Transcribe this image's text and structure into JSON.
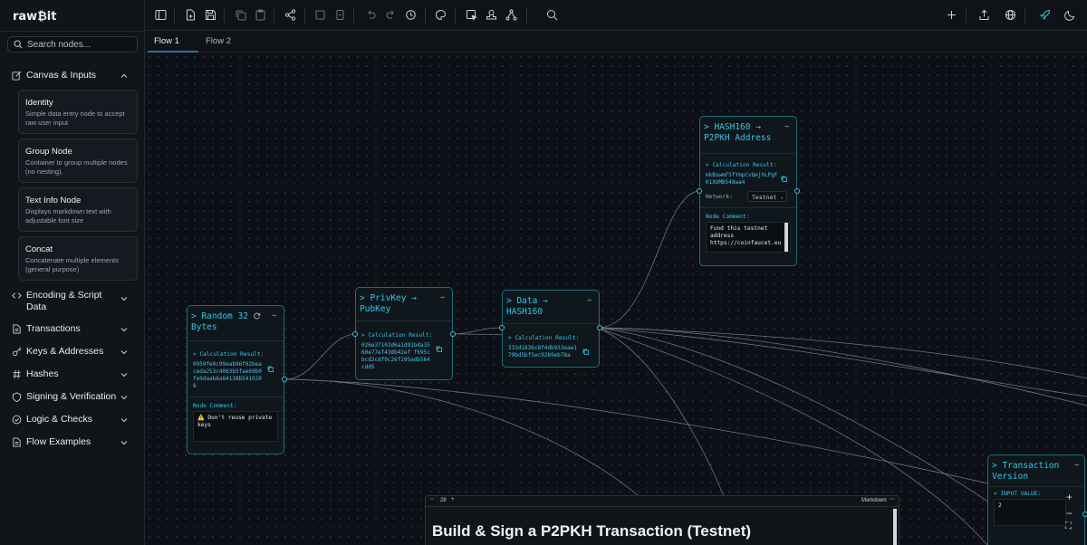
{
  "app": {
    "brand": "raw₿it"
  },
  "sidebar": {
    "search_placeholder": "Search nodes...",
    "categories": [
      {
        "label": "Canvas & Inputs",
        "icon": "edit-square-icon",
        "expanded": true
      },
      {
        "label": "Encoding & Script Data",
        "icon": "code-icon"
      },
      {
        "label": "Transactions",
        "icon": "document-icon"
      },
      {
        "label": "Keys & Addresses",
        "icon": "key-icon"
      },
      {
        "label": "Hashes",
        "icon": "hash-icon"
      },
      {
        "label": "Signing & Verification",
        "icon": "shield-icon"
      },
      {
        "label": "Logic & Checks",
        "icon": "check-circle-icon"
      },
      {
        "label": "Flow Examples",
        "icon": "document-icon"
      }
    ],
    "cards": [
      {
        "title": "Identity",
        "desc": "Simple data entry node to accept raw user input"
      },
      {
        "title": "Group Node",
        "desc": "Container to group multiple nodes (no nesting)."
      },
      {
        "title": "Text Info Node",
        "desc": "Displays markdown text with adjustable font size"
      },
      {
        "title": "Concat",
        "desc": "Concatenate multiple elements (general purpose)"
      }
    ]
  },
  "tabs": [
    "Flow 1",
    "Flow 2"
  ],
  "nodes": {
    "random": {
      "title": "> Random 32 Bytes",
      "result_label": "> Calculation Result:",
      "result": "0959fe0c99eab96f02beaceda253c4083b5fae69b0fe9daab6a84138b5410208",
      "comment_label": "Node Comment:",
      "comment": "⚠️ Don't reuse private keys"
    },
    "privkey": {
      "title": "> PrivKey → PubKey",
      "result_label": "> Calculation Result:",
      "result": "026e37102d6a1d91bda3560e77ef438b42ef f695cbcd2cdf9c26f295adb564cdd5"
    },
    "data160": {
      "title": "> Data → HASH160",
      "result_label": "> Calculation Result:",
      "result": "333d1836c8f4db933eae179bd5bf5ec9289eb78a"
    },
    "p2pkh": {
      "title": "> HASH160 → P2PKH Address",
      "result_label": "> Calculation Result:",
      "result": "mkBswmF5fYmpCvQejhLPgFK1XUMB548wa4",
      "network_label": "Network:",
      "network": "Testnet",
      "comment_label": "Node Comment:",
      "comment": "Fund this testnet address https://coinfaucet.eu"
    },
    "txver": {
      "title": "> Transaction Version",
      "input_label": "> INPUT VALUE:",
      "input": "2"
    }
  },
  "markdown": {
    "font_size": "28",
    "mode": "Markdown",
    "heading": "Build & Sign a P2PKH Transaction (Testnet)"
  },
  "colors": {
    "accent": "#38c6e6",
    "node_border": "#1b6f78",
    "background": "#0d1117"
  }
}
